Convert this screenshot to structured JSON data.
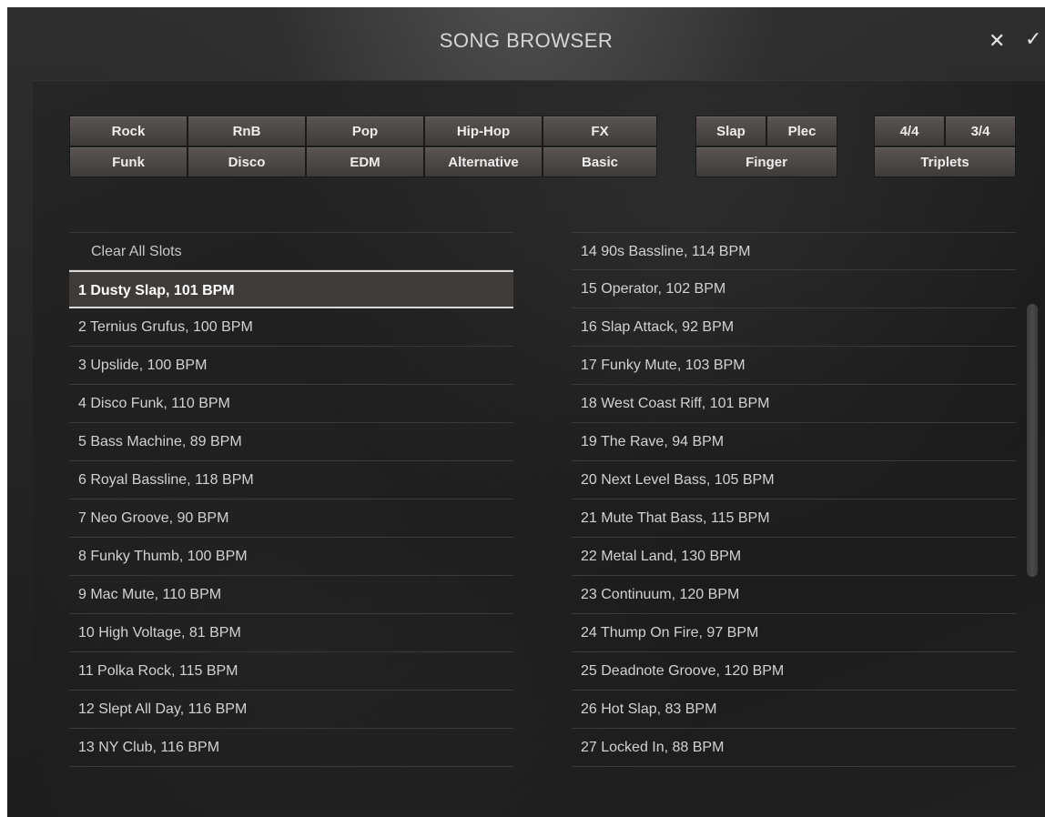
{
  "header": {
    "title": "SONG BROWSER",
    "close_glyph": "✕",
    "confirm_glyph": "✓"
  },
  "filters": {
    "genres_row1": [
      "Rock",
      "RnB",
      "Pop",
      "Hip-Hop",
      "FX"
    ],
    "genres_row2": [
      "Funk",
      "Disco",
      "EDM",
      "Alternative",
      "Basic"
    ],
    "technique_row1": [
      "Slap",
      "Plec"
    ],
    "technique_row2": "Finger",
    "meter_row1": [
      "4/4",
      "3/4"
    ],
    "meter_row2": "Triplets"
  },
  "list": {
    "clear_label": "Clear All Slots",
    "left": [
      "1  Dusty Slap, 101 BPM",
      "2  Ternius Grufus, 100 BPM",
      "3  Upslide, 100 BPM",
      "4  Disco Funk, 110 BPM",
      "5  Bass Machine, 89 BPM",
      "6  Royal Bassline, 118 BPM",
      "7  Neo Groove, 90 BPM",
      "8  Funky Thumb, 100 BPM",
      "9  Mac Mute, 110 BPM",
      "10  High Voltage, 81 BPM",
      "11  Polka Rock, 115 BPM",
      "12  Slept All Day, 116 BPM",
      "13  NY Club, 116 BPM"
    ],
    "right": [
      "14  90s Bassline, 114 BPM",
      "15  Operator, 102 BPM",
      "16  Slap Attack, 92 BPM",
      "17  Funky Mute, 103 BPM",
      "18  West Coast Riff, 101 BPM",
      "19  The Rave, 94 BPM",
      "20  Next Level Bass, 105 BPM",
      "21  Mute That Bass, 115 BPM",
      "22  Metal Land, 130 BPM",
      "23  Continuum, 120 BPM",
      "24  Thump On Fire, 97 BPM",
      "25  Deadnote Groove, 120 BPM",
      "26  Hot Slap, 83 BPM",
      "27  Locked In, 88 BPM"
    ],
    "selected": "1  Dusty Slap, 101 BPM"
  },
  "colors": {
    "background": "#1e1e1e",
    "button": "#4a4644",
    "text": "#d2d2d2",
    "selected_row": "#3e3b39"
  }
}
